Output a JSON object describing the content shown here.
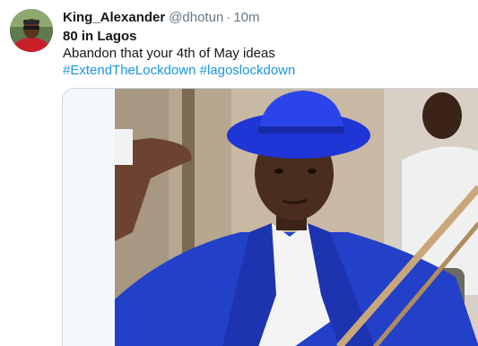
{
  "tweet": {
    "author": {
      "display_name": "King_Alexander",
      "handle": "@dhotun",
      "avatar_icon": "profile-avatar"
    },
    "separator": "·",
    "time": "10m",
    "text": {
      "line1": "80 in Lagos",
      "line2": "Abandon that your 4th of May ideas"
    },
    "hashtags": [
      "#ExtendTheLockdown",
      "#lagoslockdown"
    ],
    "media": {
      "type": "photo",
      "description_icon": "meme-photo"
    }
  },
  "colors": {
    "link": "#1b95e0",
    "secondary_text": "#657786",
    "border": "#ccd6dd",
    "hat_blue": "#1f35d6",
    "suit_blue": "#2340c8"
  }
}
